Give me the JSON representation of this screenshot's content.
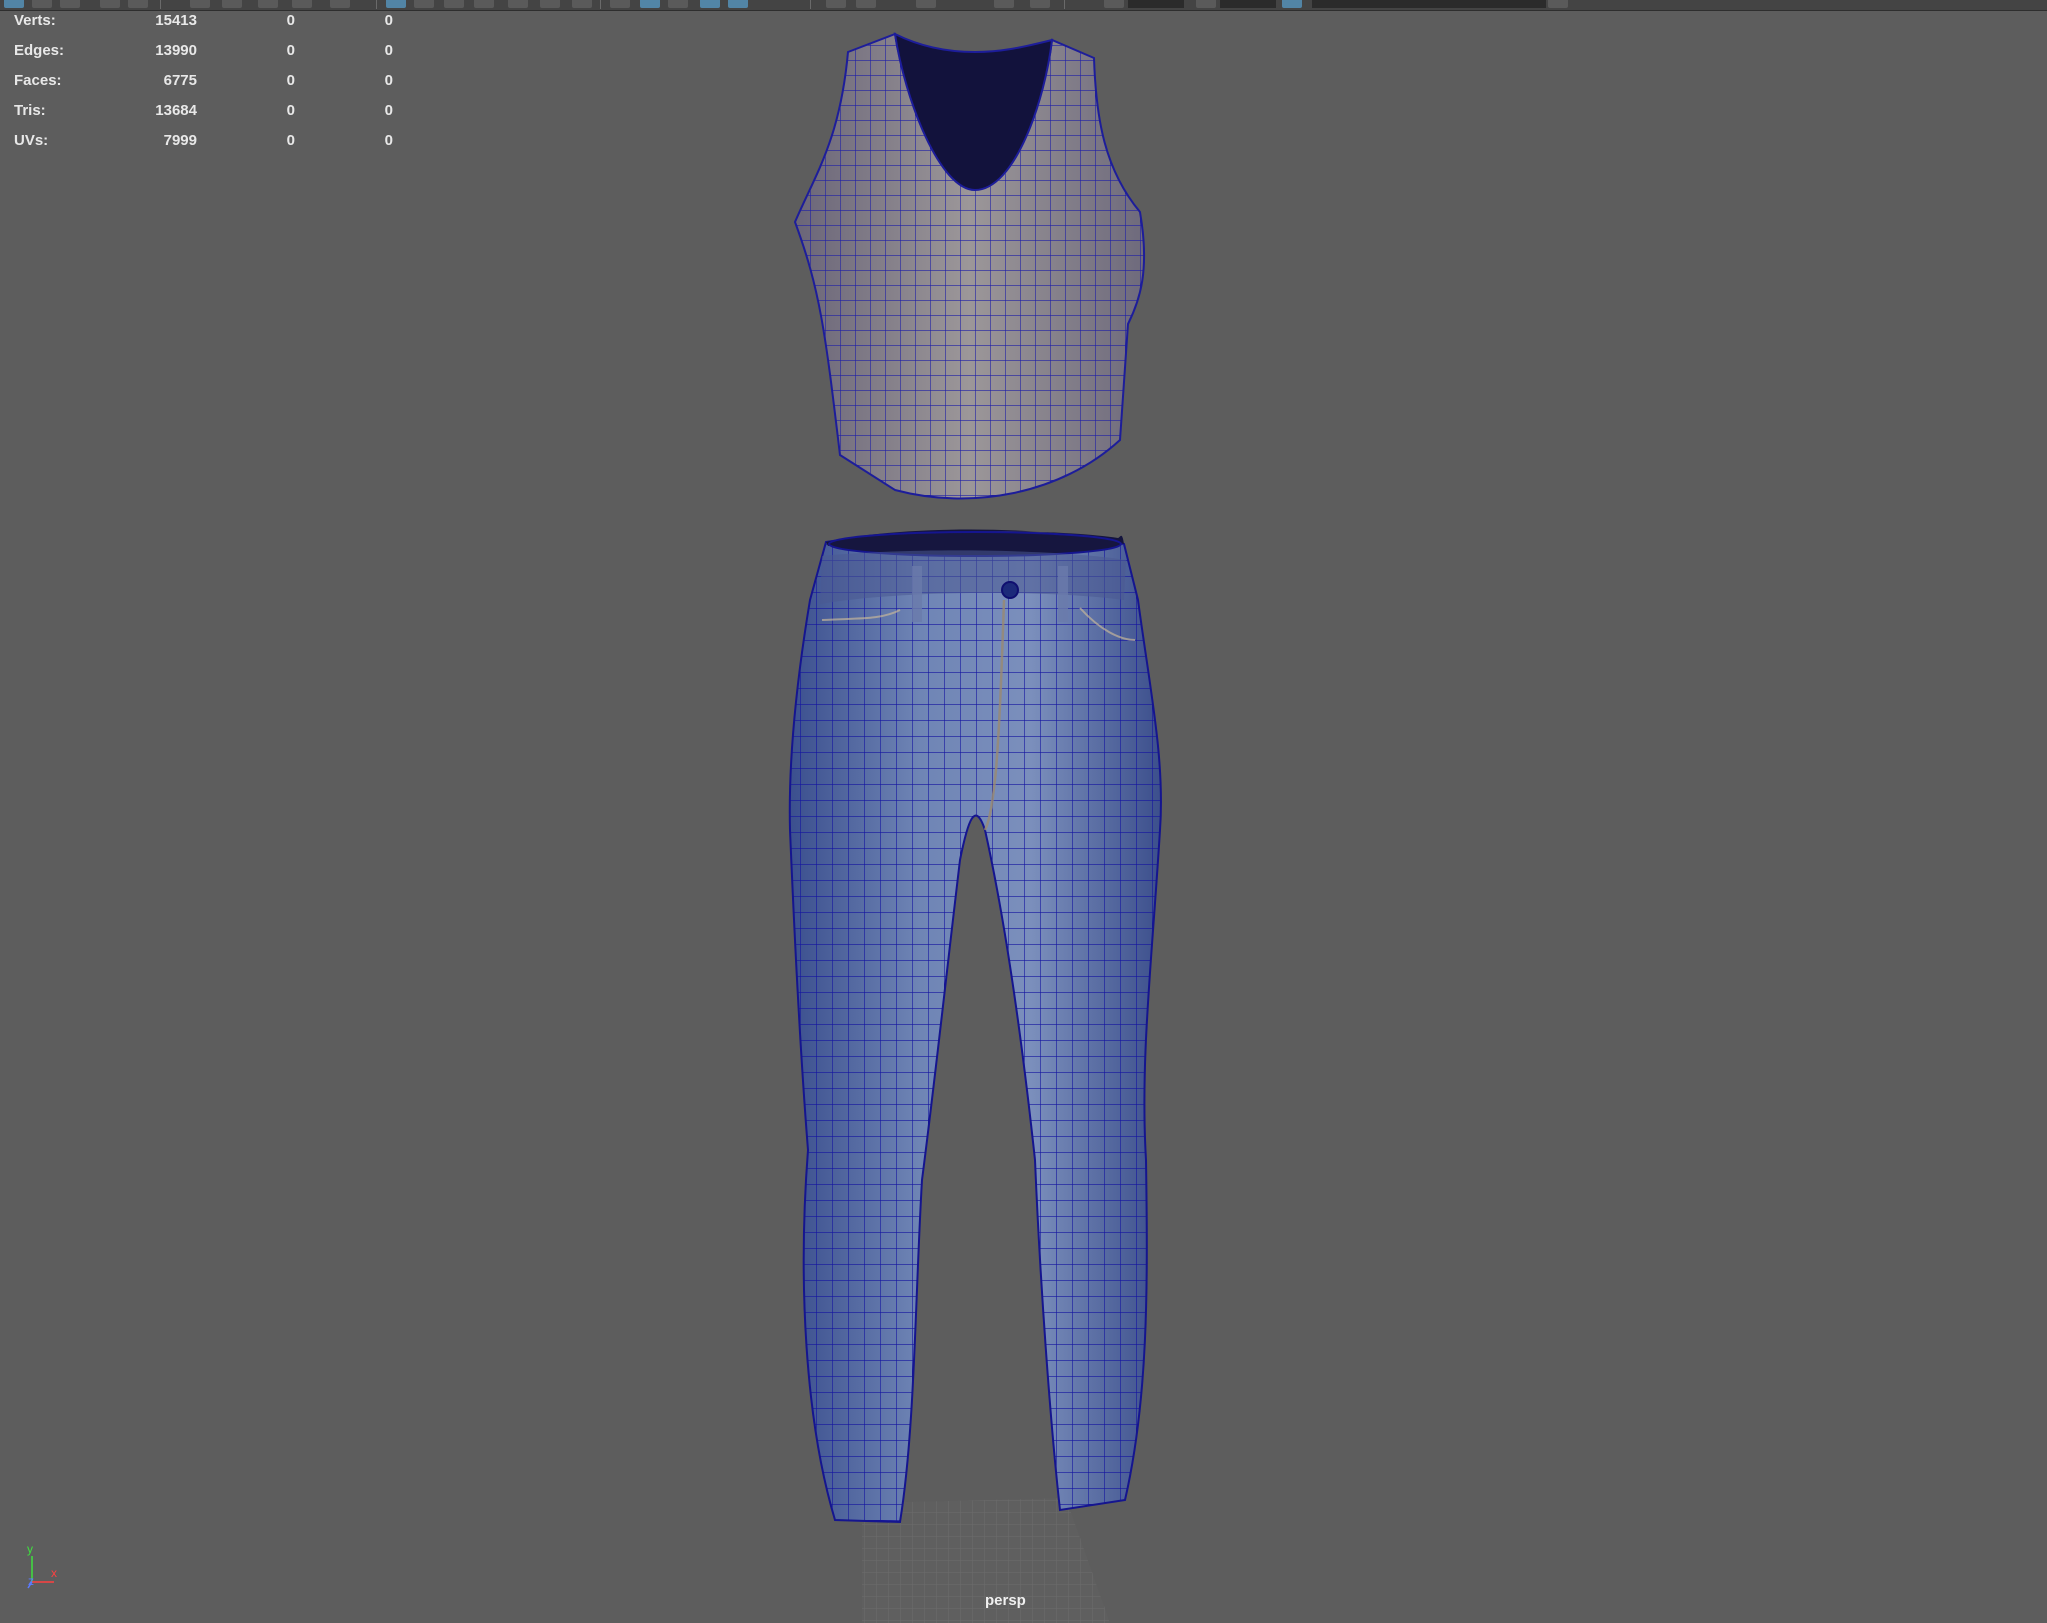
{
  "hud": {
    "rows": [
      {
        "label": "Verts:",
        "v1": "15413",
        "v2": "0",
        "v3": "0"
      },
      {
        "label": "Edges:",
        "v1": "13990",
        "v2": "0",
        "v3": "0"
      },
      {
        "label": "Faces:",
        "v1": "6775",
        "v2": "0",
        "v3": "0"
      },
      {
        "label": "Tris:",
        "v1": "13684",
        "v2": "0",
        "v3": "0"
      },
      {
        "label": "UVs:",
        "v1": "7999",
        "v2": "0",
        "v3": "0"
      }
    ]
  },
  "viewport": {
    "camera": "persp",
    "background_color": "#5d5d5d",
    "wireframe_color": "#1a1aa8"
  },
  "axis": {
    "y": "y",
    "x": "x",
    "z": "z"
  },
  "icons": [
    "toolbar-icon",
    "grid-icon",
    "wireframe-icon",
    "shaded-icon",
    "axis-gizmo-icon"
  ]
}
